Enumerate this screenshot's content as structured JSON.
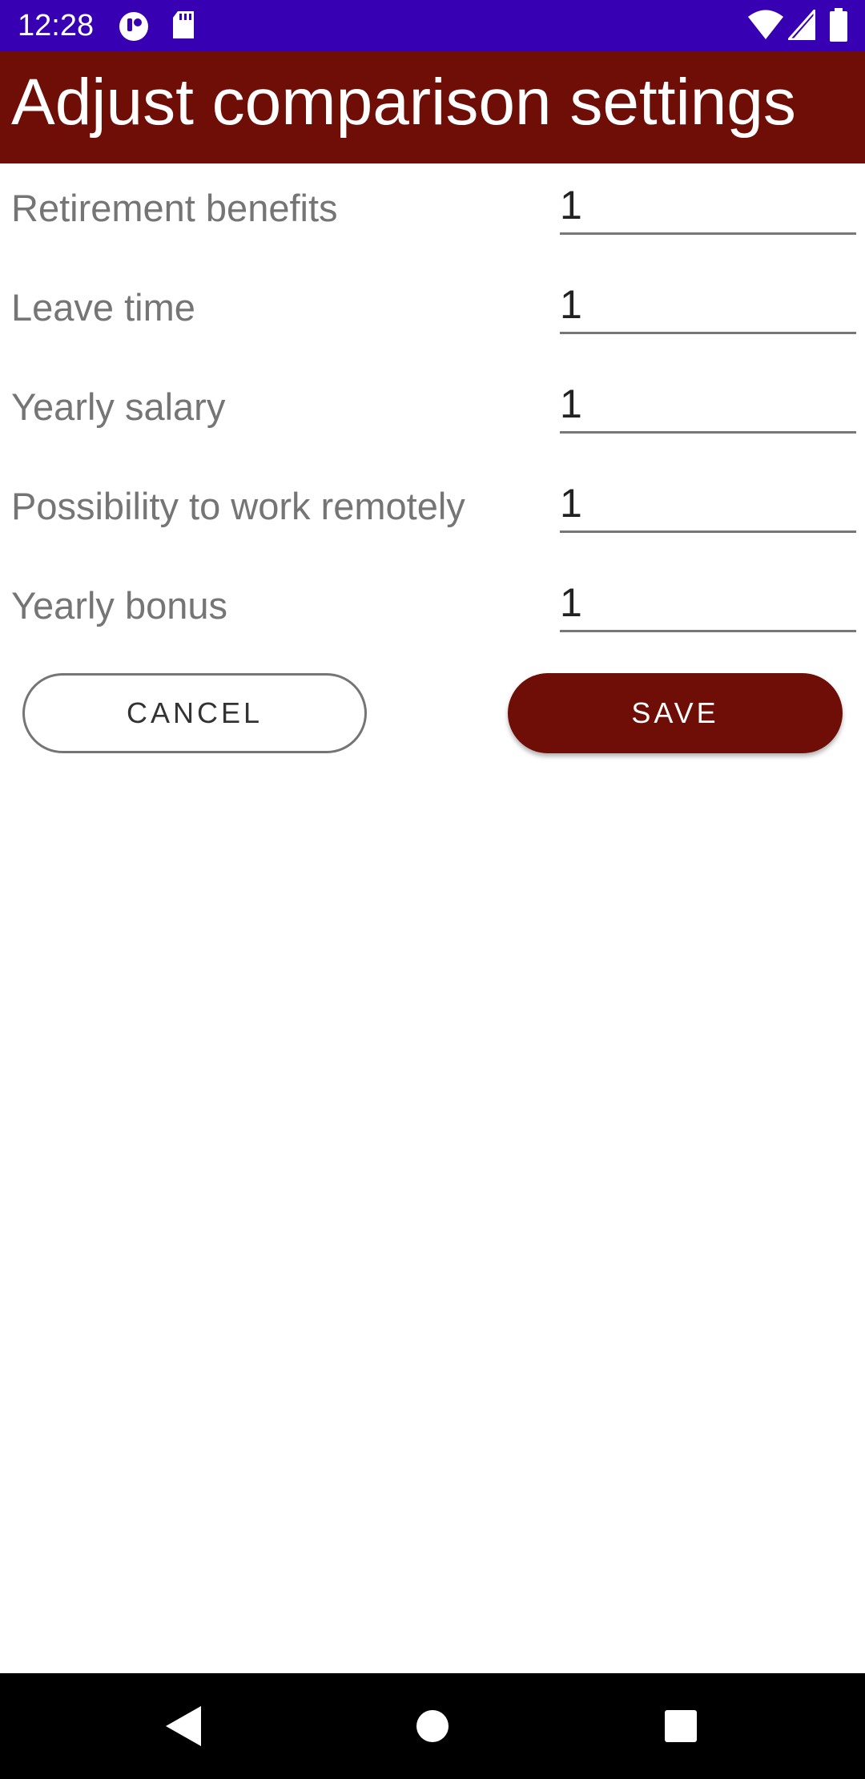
{
  "status_bar": {
    "time": "12:28",
    "background": "#3700b3",
    "icons": [
      "app-notification-icon",
      "sd-card-icon",
      "wifi-icon",
      "cellular-signal-icon",
      "battery-icon"
    ]
  },
  "app_bar": {
    "title": "Adjust comparison settings",
    "background": "#6e0e07"
  },
  "form": {
    "fields": [
      {
        "label": "Retirement benefits",
        "value": "1"
      },
      {
        "label": "Leave time",
        "value": "1"
      },
      {
        "label": "Yearly salary",
        "value": "1"
      },
      {
        "label": "Possibility to work remotely",
        "value": "1"
      },
      {
        "label": "Yearly bonus",
        "value": "1"
      }
    ]
  },
  "actions": {
    "cancel_label": "CANCEL",
    "save_label": "SAVE",
    "accent": "#6e0e07"
  },
  "nav_bar": {
    "icons": [
      "back-icon",
      "home-icon",
      "recents-icon"
    ]
  }
}
